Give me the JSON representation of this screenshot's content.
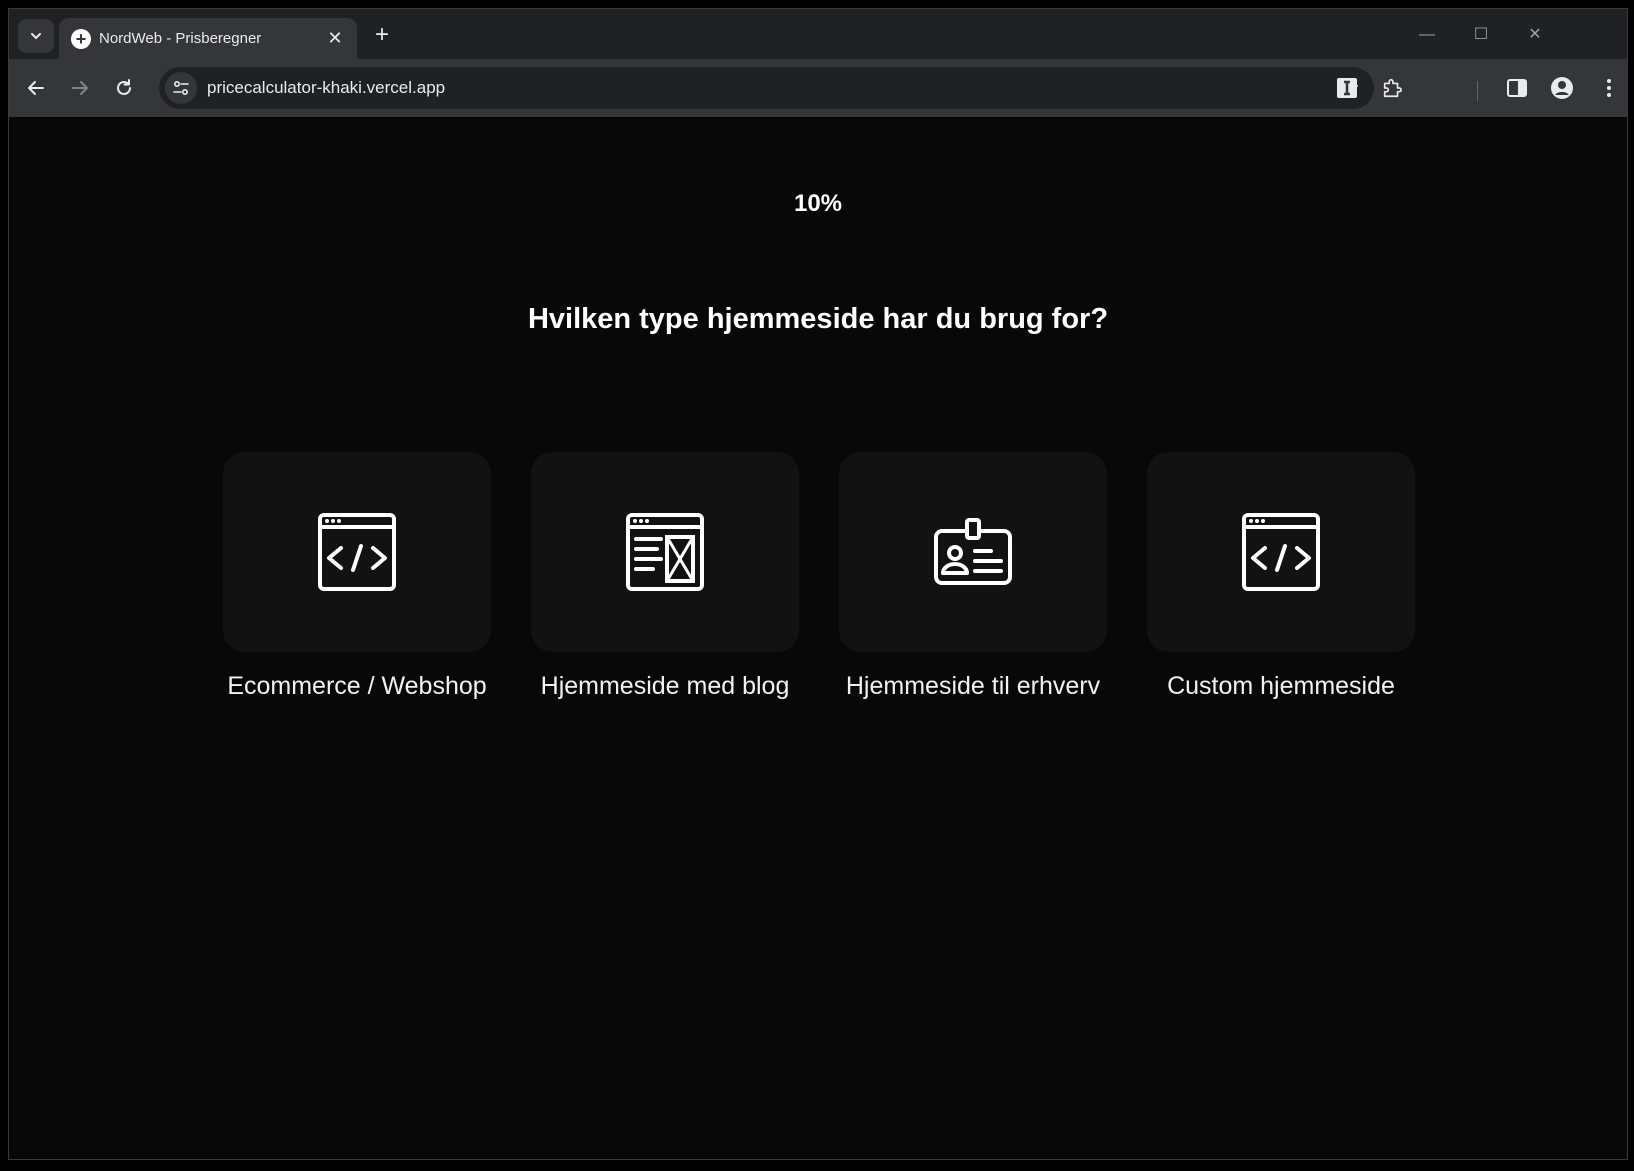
{
  "browser": {
    "tab": {
      "title": "NordWeb - Prisberegner",
      "favicon": "plus-circle-icon"
    },
    "url": "pricecalculator-khaki.vercel.app",
    "colors": {
      "frame": "#202124",
      "toolbar": "#35363a",
      "omnibox": "#202124"
    }
  },
  "page": {
    "progress_label": "10%",
    "progress_value": 0.1,
    "question": "Hvilken type hjemmeside har du brug for?",
    "options": [
      {
        "label": "Ecommerce / Webshop",
        "icon": "code-window-icon"
      },
      {
        "label": "Hjemmeside med blog",
        "icon": "blog-layout-icon"
      },
      {
        "label": "Hjemmeside til erhverv",
        "icon": "id-badge-icon"
      },
      {
        "label": "Custom hjemmeside",
        "icon": "code-window-icon"
      }
    ],
    "colors": {
      "background": "#080808",
      "card": "#121212",
      "text": "#ffffff"
    }
  }
}
